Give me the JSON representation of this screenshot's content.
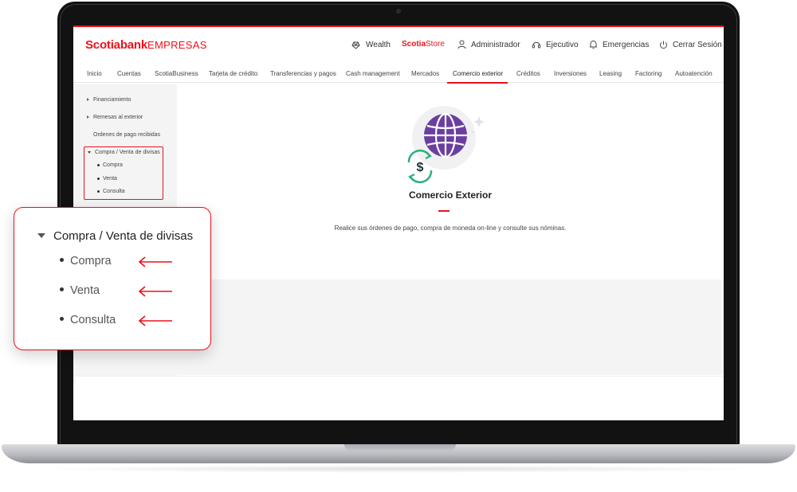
{
  "brand": {
    "name_bold": "Scotiabank",
    "name_light": "EMPRESAS",
    "accent": "#ec111a"
  },
  "utility": {
    "wealth": "Wealth",
    "store_bold": "Scotia",
    "store_rest": "Store",
    "admin": "Administrador",
    "exec": "Ejecutivo",
    "emergency": "Emergencias",
    "logout": "Cerrar Sesión"
  },
  "nav": {
    "items": [
      "Inicio",
      "Cuentas",
      "ScotiaBusiness",
      "Tarjeta de crédito",
      "Transferencias y pagos",
      "Cash management",
      "Mercados",
      "Comercio exterior",
      "Créditos",
      "Inversiones",
      "Leasing",
      "Factoring",
      "Autoatención"
    ],
    "active": "Comercio exterior"
  },
  "sidebar": {
    "financiamiento": "Financiamiento",
    "remesas": "Remesas al exterior",
    "ordenes": "Ordenes de pago recibidas",
    "divisas": "Compra / Venta de divisas",
    "compra": "Compra",
    "venta": "Venta",
    "consulta": "Consulta"
  },
  "hero": {
    "title": "Comercio Exterior",
    "description": "Realice sus órdenes de pago, compra de moneda on-line y consulte sus nóminas.",
    "icons": [
      "globe-icon",
      "dollar-exchange-icon",
      "sparkle-icon"
    ]
  },
  "callout": {
    "heading": "Compra / Venta de divisas",
    "items": [
      "Compra",
      "Venta",
      "Consulta"
    ]
  }
}
